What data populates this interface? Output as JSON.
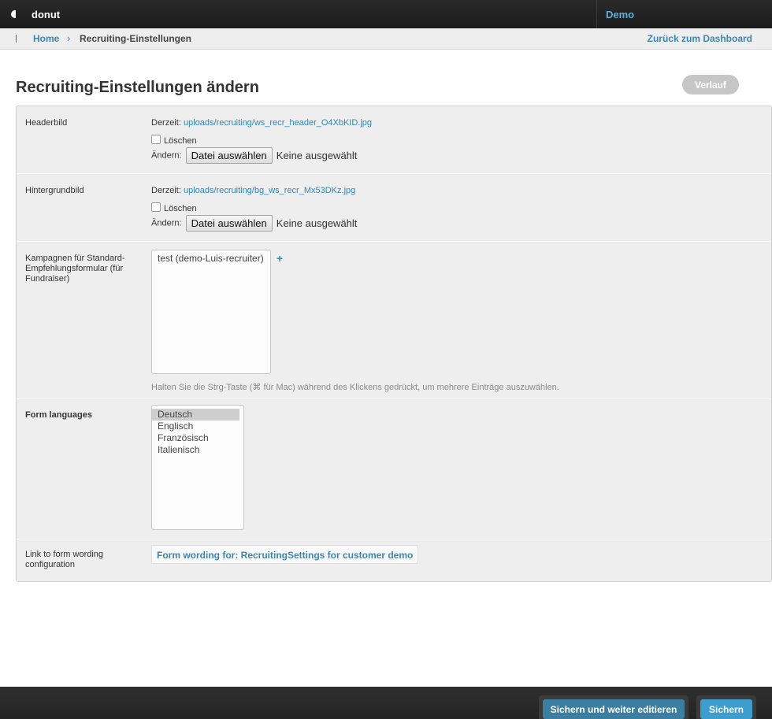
{
  "header": {
    "brand": "donut",
    "user": "Demo"
  },
  "breadcrumb": {
    "home": "Home",
    "separator": "›",
    "current": "Recruiting-Einstellungen",
    "back": "Zurück zum Dashboard"
  },
  "page": {
    "title": "Recruiting-Einstellungen ändern",
    "history_button": "Verlauf"
  },
  "form": {
    "header_image": {
      "label": "Headerbild",
      "current_prefix": "Derzeit:",
      "current_file": "uploads/recruiting/ws_recr_header_O4XbKID.jpg",
      "delete_label": "Löschen",
      "change_prefix": "Ändern:",
      "choose_button": "Datei auswählen",
      "no_file": "Keine ausgewählt"
    },
    "background_image": {
      "label": "Hintergrundbild",
      "current_prefix": "Derzeit:",
      "current_file": "uploads/recruiting/bg_ws_recr_Mx53DKz.jpg",
      "delete_label": "Löschen",
      "change_prefix": "Ändern:",
      "choose_button": "Datei auswählen",
      "no_file": "Keine ausgewählt"
    },
    "campaigns": {
      "label": "Kampagnen für Standard-Empfehlungsformular (für Fundraiser)",
      "options": [
        "test (demo-Luis-recruiter)"
      ],
      "add_symbol": "+",
      "help": "Halten Sie die Strg-Taste (⌘ für Mac) während des Klickens gedrückt, um mehrere Einträge auszuwählen."
    },
    "languages": {
      "label": "Form languages",
      "options": [
        "Deutsch",
        "Englisch",
        "Französisch",
        "Italienisch"
      ],
      "selected": "Deutsch"
    },
    "wording": {
      "label": "Link to form wording configuration",
      "link": "Form wording for: RecruitingSettings for customer demo"
    }
  },
  "footer": {
    "save_continue": "Sichern und weiter editieren",
    "save": "Sichern"
  },
  "colors": {
    "accent": "#3a86b0",
    "save_button": "#3d9dcd",
    "save_continue_button": "#3c7e9f",
    "topbar": "#222222",
    "module_bg": "#eeeeee"
  }
}
